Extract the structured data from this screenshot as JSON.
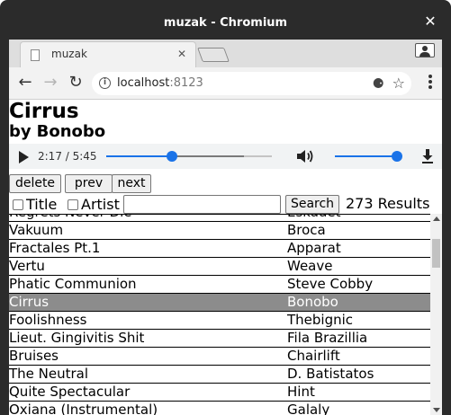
{
  "window": {
    "title": "muzak - Chromium",
    "close_glyph": "✕"
  },
  "tab": {
    "label": "muzak",
    "close_glyph": "✕"
  },
  "toolbar": {
    "back_glyph": "←",
    "forward_glyph": "→",
    "reload_glyph": "↻",
    "info_glyph": "i",
    "url_host": "localhost",
    "url_port": ":8123",
    "cookie_glyph": "⚈",
    "star_glyph": "☆"
  },
  "now_playing": {
    "title": "Cirrus",
    "by": "by",
    "artist": "Bonobo"
  },
  "player": {
    "time": "2:17 / 5:45",
    "progress": 0.397,
    "buffered": 0.83,
    "volume": 1.0,
    "accent": "#1a73e8"
  },
  "controls": {
    "delete_label": "delete",
    "prev_label": "prev",
    "next_label": "next",
    "title_label": "Title",
    "artist_label": "Artist",
    "search_value": "",
    "search_label": "Search",
    "results_label": "273 Results"
  },
  "tracks": [
    {
      "title": "Regrets Never Die",
      "artist": "Eskadet"
    },
    {
      "title": "Vakuum",
      "artist": "Broca"
    },
    {
      "title": "Fractales Pt.1",
      "artist": "Apparat"
    },
    {
      "title": "Vertu",
      "artist": "Weave"
    },
    {
      "title": "Phatic Communion",
      "artist": "Steve Cobby"
    },
    {
      "title": "Cirrus",
      "artist": "Bonobo",
      "selected": true
    },
    {
      "title": "Foolishness",
      "artist": "Thebignic"
    },
    {
      "title": "Lieut. Gingivitis Shit",
      "artist": "Fila Brazillia"
    },
    {
      "title": "Bruises",
      "artist": "Chairlift"
    },
    {
      "title": "The Neutral",
      "artist": "D. Batistatos"
    },
    {
      "title": "Quite Spectacular",
      "artist": "Hint"
    },
    {
      "title": "Oxiana (Instrumental)",
      "artist": "Galaly"
    }
  ],
  "colors": {
    "selected_row": "#8c8c8c",
    "window_chrome": "#2b2b2b"
  }
}
